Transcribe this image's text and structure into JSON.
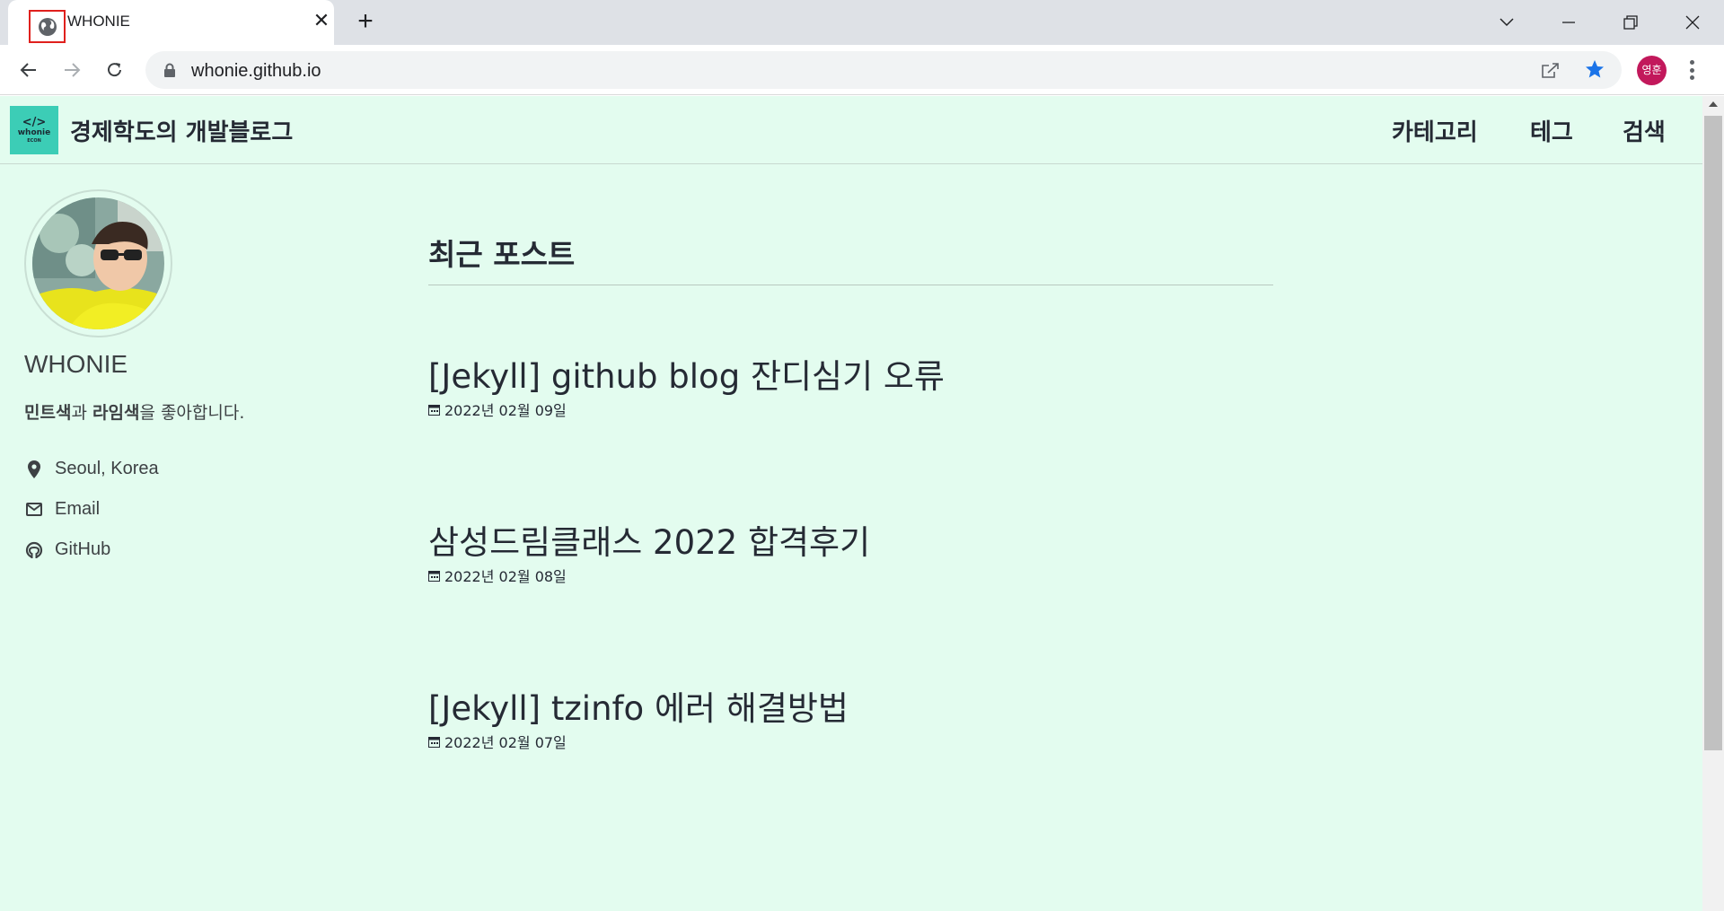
{
  "browser": {
    "tab_title": "WHONIE",
    "new_tab_symbol": "+",
    "url": "whonie.github.io",
    "profile_initials": "영훈",
    "icons": [
      "globe-icon",
      "close-icon",
      "plus-icon",
      "chevron-down-icon",
      "minimize-icon",
      "restore-icon",
      "window-close-icon",
      "back-arrow-icon",
      "forward-arrow-icon",
      "reload-icon",
      "lock-icon",
      "share-icon",
      "star-icon",
      "kebab-menu-icon"
    ],
    "colors": {
      "tabstrip": "#dee1e6",
      "star": "#1a73e8",
      "avatar": "#c2185b"
    }
  },
  "site": {
    "logo": {
      "line1": "</>",
      "line2": "whonie",
      "line3": "ECON"
    },
    "title": "경제학도의 개발블로그",
    "nav": [
      "카테고리",
      "테그",
      "검색"
    ],
    "colors": {
      "background": "#e3fcef",
      "logo": "#3ccdb6",
      "text": "#252a34"
    }
  },
  "author": {
    "name": "WHONIE",
    "bio": {
      "part1": "민트색",
      "part2": "과 ",
      "part3": "라임색",
      "part4": "을 좋아합니다."
    },
    "links": [
      {
        "icon": "map-marker-icon",
        "label": "Seoul, Korea"
      },
      {
        "icon": "envelope-icon",
        "label": "Email"
      },
      {
        "icon": "github-icon",
        "label": "GitHub"
      }
    ]
  },
  "main": {
    "section_title": "최근 포스트",
    "posts": [
      {
        "title": "[Jekyll] github blog 잔디심기 오류",
        "date": "2022년 02월 09일"
      },
      {
        "title": "삼성드림클래스 2022 합격후기",
        "date": "2022년 02월 08일"
      },
      {
        "title": "[Jekyll] tzinfo 에러 해결방법",
        "date": "2022년 02월 07일"
      }
    ]
  }
}
